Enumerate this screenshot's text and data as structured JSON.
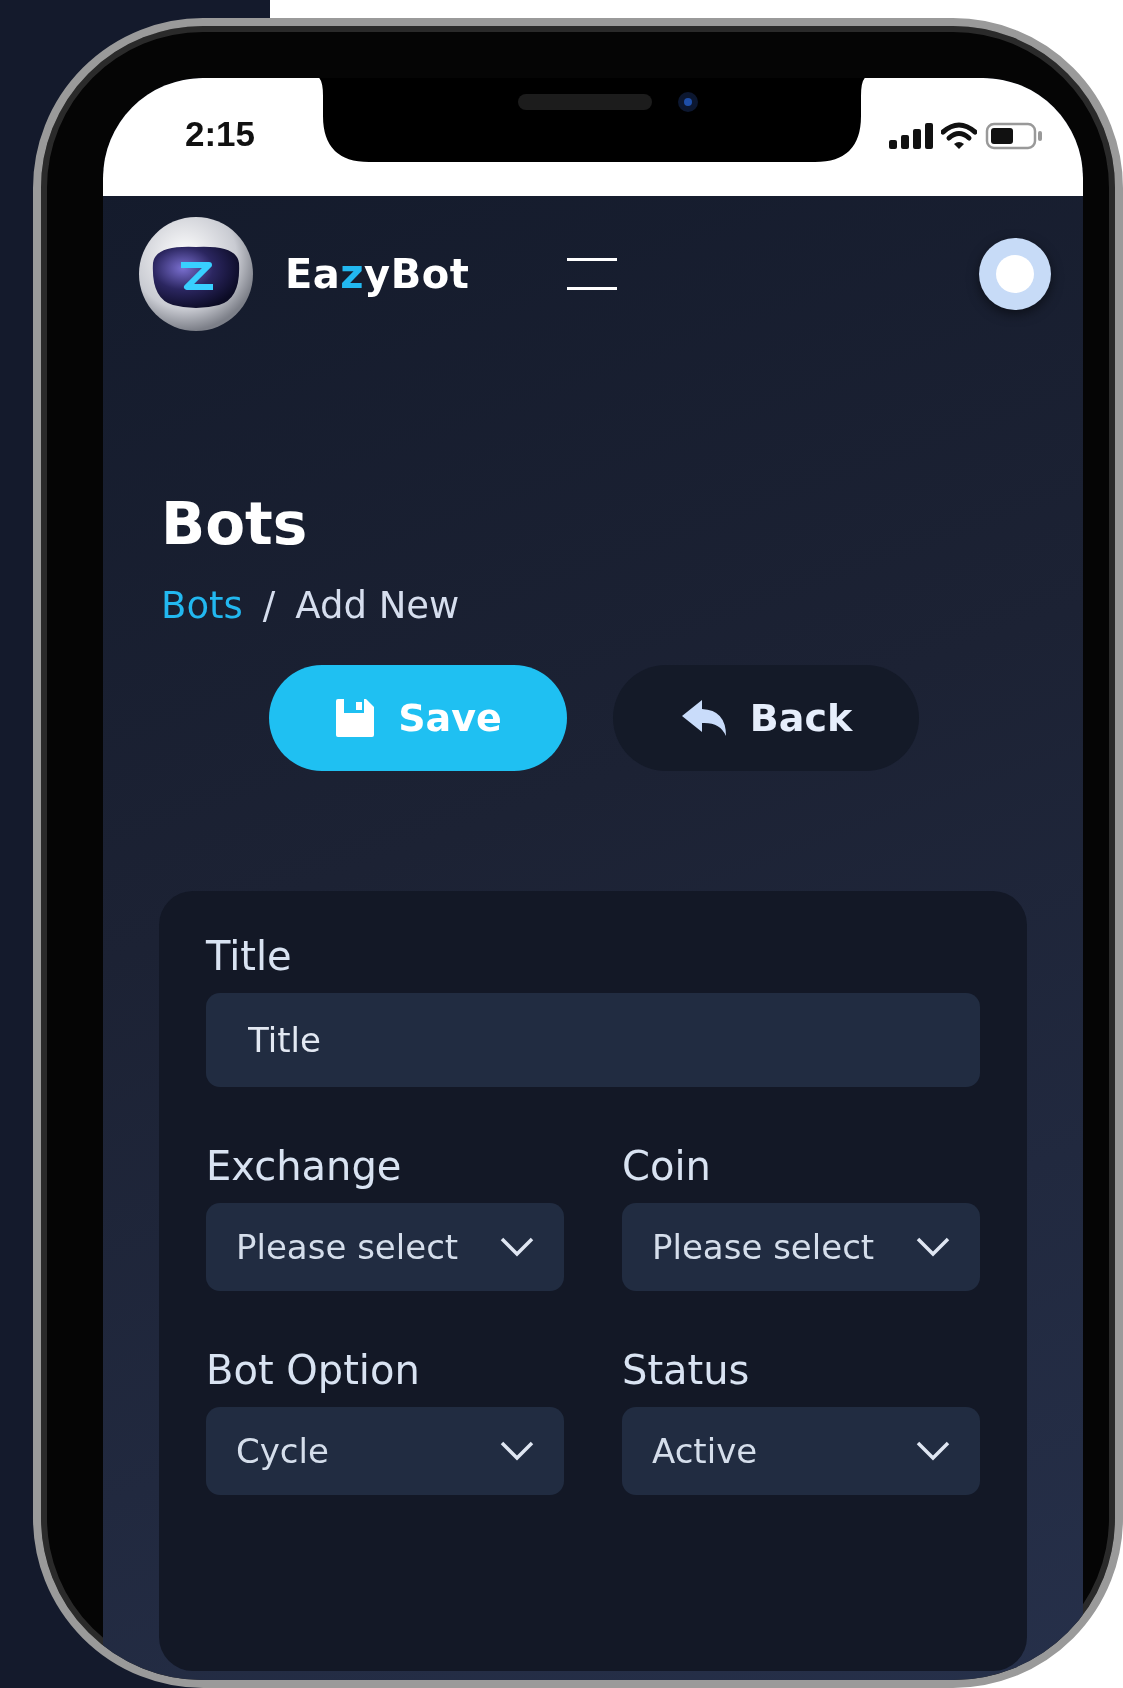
{
  "status_bar": {
    "time": "2:15"
  },
  "header": {
    "brand": [
      {
        "text": "Ea",
        "accent": false
      },
      {
        "text": "z",
        "accent": true
      },
      {
        "text": "yBot",
        "accent": false
      }
    ]
  },
  "page": {
    "title": "Bots",
    "separator": "/",
    "breadcrumb": [
      {
        "label": "Bots",
        "kind": "link"
      },
      {
        "label": "Add New",
        "kind": "current"
      }
    ]
  },
  "buttons": [
    {
      "label": "Save",
      "kind": "primary"
    },
    {
      "label": "Back",
      "kind": "secondary"
    }
  ],
  "form": {
    "fields": [
      {
        "label": "Title",
        "kind": "text",
        "placeholder": "Title"
      },
      {
        "label": "Exchange",
        "kind": "select",
        "value": "Please select"
      },
      {
        "label": "Coin",
        "kind": "select",
        "value": "Please select"
      },
      {
        "label": "Bot Option",
        "kind": "select",
        "value": "Cycle"
      },
      {
        "label": "Status",
        "kind": "select",
        "value": "Active"
      }
    ]
  }
}
